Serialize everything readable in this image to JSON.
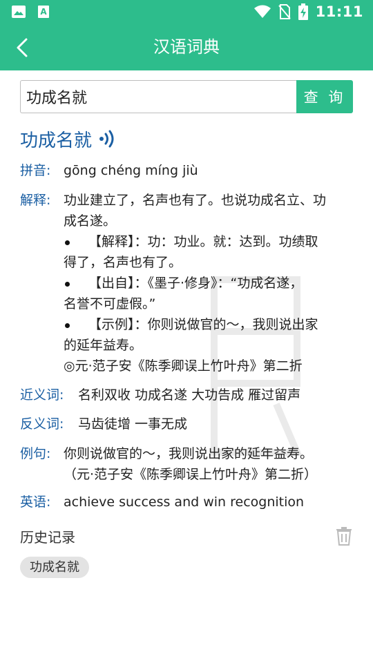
{
  "status_bar": {
    "time": "11:11"
  },
  "toolbar": {
    "title": "汉语词典"
  },
  "search": {
    "value": "功成名就",
    "button_label": "查 询"
  },
  "entry": {
    "word": "功成名就",
    "pinyin_label": "拼音:",
    "pinyin": "gōng chéng míng jiù",
    "explain_label": "解释:",
    "explain_line1": "功业建立了，名声也有了。也说功成名立、功",
    "explain_line2": "成名遂。",
    "bullet1_line1": "【解释】：功：功业。就：达到。功绩取",
    "bullet1_line2": "得了，名声也有了。",
    "bullet2_line1": "【出自】：《墨子·修身》：“功成名遂，",
    "bullet2_line2": "名誉不可虚假。”",
    "bullet3_line1": "【示例】：你则说做官的～，我则说出家",
    "bullet3_line2": "的延年益寿。",
    "explain_source": "◎元·范子安《陈季卿误上竹叶舟》第二折",
    "synonym_label": "近义词:",
    "synonyms": "名利双收 功成名遂 大功告成 雁过留声",
    "antonym_label": "反义词:",
    "antonyms": "马齿徒增 一事无成",
    "example_label": "例句:",
    "example_line1": "你则说做官的～，我则说出家的延年益寿。",
    "example_line2": "（元·范子安《陈季卿误上竹叶舟》第二折）",
    "english_label": "英语:",
    "english": "achieve success and win recognition"
  },
  "history": {
    "title": "历史记录",
    "items": [
      "功成名就"
    ]
  },
  "icons": {
    "status_left": [
      "image-icon",
      "app-icon"
    ],
    "status_right": [
      "wifi-icon",
      "no-sim-icon",
      "battery-charging-icon"
    ],
    "back": "chevron-left-icon",
    "speaker": "speaker-icon",
    "trash": "trash-icon"
  },
  "colors": {
    "accent": "#2dbd8c",
    "label_blue": "#1b5fa3",
    "chip_bg": "#e3e3e3"
  }
}
